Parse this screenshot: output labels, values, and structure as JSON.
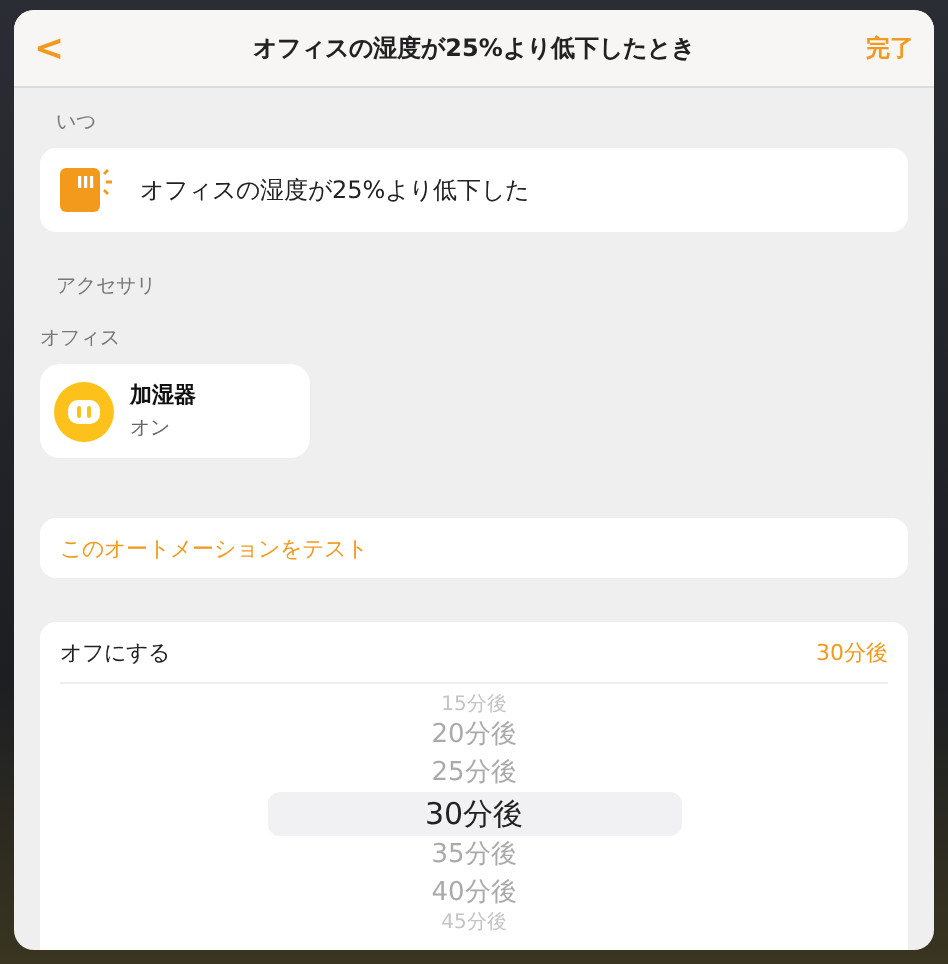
{
  "header": {
    "back": "<",
    "title": "オフィスの湿度が25%より低下したとき",
    "done": "完了"
  },
  "trigger": {
    "section": "いつ",
    "label": "オフィスの湿度が25%より低下した"
  },
  "accessories": {
    "section": "アクセサリ",
    "room": "オフィス",
    "items": [
      {
        "name": "加湿器",
        "status": "オン",
        "on": true
      }
    ]
  },
  "test_button": "このオートメーションをテスト",
  "turn_off": {
    "label": "オフにする",
    "value": "30分後",
    "picker": [
      {
        "label": "15分後",
        "selected": false
      },
      {
        "label": "20分後",
        "selected": false
      },
      {
        "label": "25分後",
        "selected": false
      },
      {
        "label": "30分後",
        "selected": true
      },
      {
        "label": "35分後",
        "selected": false
      },
      {
        "label": "40分後",
        "selected": false
      },
      {
        "label": "45分後",
        "selected": false
      }
    ]
  }
}
